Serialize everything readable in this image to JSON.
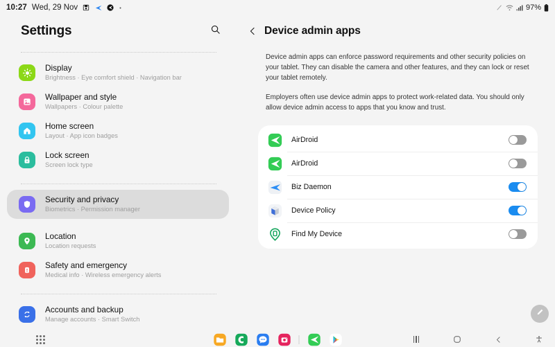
{
  "status_bar": {
    "time": "10:27",
    "date": "Wed, 29 Nov",
    "icons": [
      "screenshot-icon",
      "airdroid-icon",
      "black-circle-icon",
      "dot-icon"
    ],
    "right_icons": [
      "pen-icon",
      "wifi-icon",
      "signal-icon"
    ],
    "battery": "97%"
  },
  "sidebar": {
    "title": "Settings",
    "search_icon": "search-icon",
    "items": [
      {
        "label": "Display",
        "sub": "Brightness  ·  Eye comfort shield  ·  Navigation bar",
        "icon": "display-icon",
        "color": "#8cd817",
        "selected": false,
        "group_start": true
      },
      {
        "label": "Wallpaper and style",
        "sub": "Wallpapers  ·  Colour palette",
        "icon": "wallpaper-icon",
        "color": "#f4689b",
        "selected": false,
        "group_start": false
      },
      {
        "label": "Home screen",
        "sub": "Layout  ·  App icon badges",
        "icon": "home-icon",
        "color": "#32c5f0",
        "selected": false,
        "group_start": false
      },
      {
        "label": "Lock screen",
        "sub": "Screen lock type",
        "icon": "lock-icon",
        "color": "#2bbd9e",
        "selected": false,
        "group_start": false
      },
      {
        "label": "Security and privacy",
        "sub": "Biometrics  ·  Permission manager",
        "icon": "shield-icon",
        "color": "#7a6bf2",
        "selected": true,
        "group_start": true
      },
      {
        "label": "Location",
        "sub": "Location requests",
        "icon": "location-pin-icon",
        "color": "#3cb953",
        "selected": false,
        "group_start": false
      },
      {
        "label": "Safety and emergency",
        "sub": "Medical info  ·  Wireless emergency alerts",
        "icon": "emergency-icon",
        "color": "#f0635c",
        "selected": false,
        "group_start": false
      },
      {
        "label": "Accounts and backup",
        "sub": "Manage accounts  ·  Smart Switch",
        "icon": "sync-icon",
        "color": "#3a70e8",
        "selected": false,
        "group_start": true
      }
    ]
  },
  "main": {
    "back_icon": "chevron-left-icon",
    "title": "Device admin apps",
    "paragraphs": [
      "Device admin apps can enforce password requirements and other security policies on your tablet. They can disable the camera and other features, and they can lock or reset your tablet remotely.",
      "Employers often use device admin apps to protect work-related data. You should only allow device admin access to apps that you know and trust."
    ],
    "apps": [
      {
        "name": "AirDroid",
        "icon": "airdroid-icon",
        "enabled": false
      },
      {
        "name": "AirDroid",
        "icon": "airdroid-icon",
        "enabled": false
      },
      {
        "name": "Biz Daemon",
        "icon": "biz-daemon-icon",
        "enabled": true
      },
      {
        "name": "Device Policy",
        "icon": "device-policy-icon",
        "enabled": true
      },
      {
        "name": "Find My Device",
        "icon": "find-my-device-icon",
        "enabled": false
      }
    ]
  },
  "fab": {
    "icon": "edit-pencil-icon"
  },
  "taskbar": {
    "app_drawer_icon": "app-drawer-icon",
    "dock": [
      {
        "name": "My Files",
        "icon": "folder-icon",
        "color": "#f7a823"
      },
      {
        "name": "Phone",
        "icon": "phone-icon",
        "color": "#16a95a"
      },
      {
        "name": "Messages",
        "icon": "message-icon",
        "color": "#2a7df0"
      },
      {
        "name": "Instagram",
        "icon": "camera-icon",
        "color": "#e5245e"
      },
      {
        "name": "AirDroid",
        "icon": "airdroid-icon",
        "color": "#3ac255"
      },
      {
        "name": "Play Store",
        "icon": "play-store-icon",
        "color": "#ffffff"
      }
    ],
    "nav": [
      {
        "name": "Recents",
        "icon": "recents-icon"
      },
      {
        "name": "Home",
        "icon": "home-square-icon"
      },
      {
        "name": "Back",
        "icon": "back-chevron-icon"
      },
      {
        "name": "Accessibility",
        "icon": "accessibility-icon"
      }
    ]
  },
  "colors": {
    "background": "#f4f4f4",
    "card": "#ffffff",
    "selected_row": "#dcdcdc",
    "toggle_on": "#1a8cf0",
    "toggle_off": "#9a9a9a"
  }
}
